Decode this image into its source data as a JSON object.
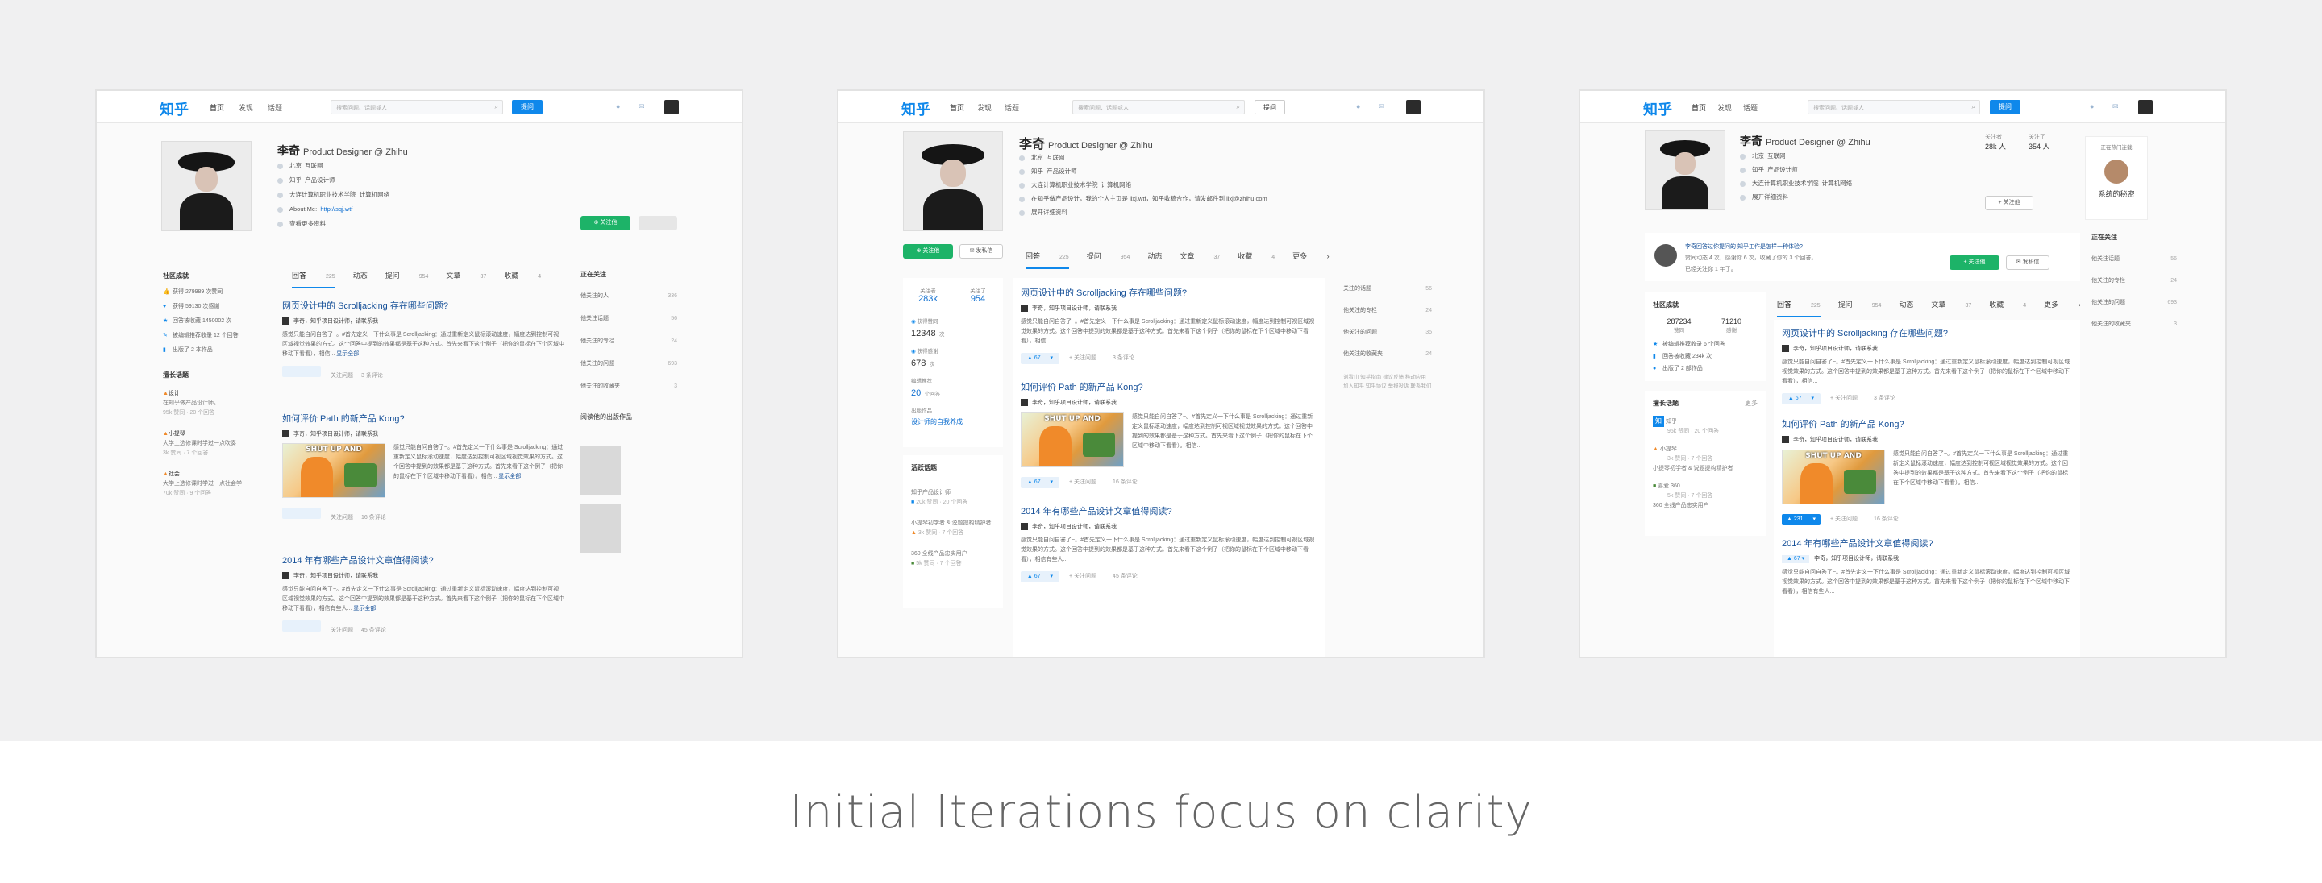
{
  "caption": "Initial Iterations focus on clarity",
  "header": {
    "logo": "知乎",
    "nav": [
      "首页",
      "发现",
      "话题"
    ],
    "search_placeholder": "搜索问题、话题或人",
    "ask_label": "提问"
  },
  "profile": {
    "name": "李奇",
    "headline": "Product Designer @ Zhihu",
    "location": "北京",
    "industry": "互联网",
    "company": "知乎",
    "job": "产品设计师",
    "school": "大连计算机职业技术学院",
    "major": "计算机网络",
    "about_label": "About Me:",
    "about_link": "http://sqj.wtf",
    "bio": "在知乎做产品设计，我的个人主页是 lixj.wtf，知乎收稿合作，请发邮件到 lixj@zhihu.com",
    "show_more": "查看更多资料",
    "expand_more": "展开详细资料",
    "follow_label": "关注他",
    "message_label": "发私信"
  },
  "tabs": [
    {
      "label": "回答",
      "count": "225"
    },
    {
      "label": "动态",
      "count": ""
    },
    {
      "label": "提问",
      "count": "954"
    },
    {
      "label": "文章",
      "count": "37"
    },
    {
      "label": "收藏",
      "count": "4"
    },
    {
      "label": "更多",
      "count": ""
    }
  ],
  "answers": [
    {
      "title": "网页设计中的 Scrolljacking 存在哪些问题?",
      "author": "李奇，知乎项目设计师，请联系我",
      "excerpt": "感觉只能自问自答了~。#首先定义一下什么事是 Scrolljacking：通过重新定义鼠标滚动速度，幅度达到控制可视区域视觉效果的方式。这个回答中提到的效果都是基于这种方式。首先来看下这个例子（把你的鼠标在下个区域中移动下看看），相信...",
      "more": "显示全部",
      "votes": "67",
      "comments": "3 条评论",
      "follow": "关注问题"
    },
    {
      "title": "如何评价 Path 的新产品 Kong?",
      "author": "李奇，知乎项目设计师，请联系我",
      "excerpt": "感觉只能自问自答了~。#首先定义一下什么事是 Scrolljacking：通过重新定义鼠标滚动速度，幅度达到控制可视区域视觉效果的方式。这个回答中提到的效果都是基于这种方式。首先来看下这个例子（把你的鼠标在下个区域中移动下看看）。相信...",
      "more": "显示全部",
      "meme": "SHUT UP AND",
      "votes": "231",
      "comments": "16 条评论",
      "follow": "关注问题"
    },
    {
      "title": "2014 年有哪些产品设计文章值得阅读?",
      "author": "李奇，知乎项目设计师，请联系我",
      "excerpt": "感觉只能自问自答了~。#首先定义一下什么事是 Scrolljacking：通过重新定义鼠标滚动速度，幅度达到控制可视区域视觉效果的方式。这个回答中提到的效果都是基于这种方式。首先来看下这个例子（把你的鼠标在下个区域中移动下看看），相信有些人...",
      "more": "显示全部",
      "votes": "67",
      "comments": "45 条评论",
      "follow": "关注问题"
    }
  ],
  "community": {
    "heading": "社区成就",
    "items": [
      "获得 279989 次赞同",
      "获得 59130 次感谢",
      "回答被收藏 1450002 次",
      "被编辑推荐收录 12 个回答",
      "出版了 2 本作品"
    ]
  },
  "expert": {
    "heading": "擅长话题",
    "topics": [
      {
        "name": "设计",
        "desc": "在知乎做产品设计师。",
        "stats": "95k 赞同 · 20 个回答"
      },
      {
        "name": "小提琴",
        "desc": "大学上选修课时学过一点吹奏",
        "stats": "3k 赞同 · 7 个回答"
      },
      {
        "name": "社会",
        "desc": "大学上选修课时学过一点社会学",
        "stats": "70k 赞同 · 9 个回答"
      }
    ]
  },
  "following": {
    "heading": "正在关注",
    "items": [
      {
        "label": "他关注的人",
        "count": "336"
      },
      {
        "label": "他关注话题",
        "count": "56"
      },
      {
        "label": "他关注的专栏",
        "count": "24"
      },
      {
        "label": "他关注的问题",
        "count": "693"
      },
      {
        "label": "他关注的收藏夹",
        "count": "3"
      }
    ]
  },
  "publications_heading": "阅读他的出版作品",
  "stats": {
    "followers_label": "关注者",
    "followers": "283k",
    "following_label": "关注了",
    "following": "954",
    "views_label": "获得赞同",
    "views": "12348",
    "thanks_label": "获得感谢",
    "thanks": "678",
    "recommend_label": "编辑推荐",
    "recommend": "20",
    "pub_label": "出版作品",
    "pub_value": "设计师的自我养成",
    "count_unit": "次",
    "answer_unit": "个回答",
    "followers3": "28k",
    "following3": "354",
    "community3_a": "287234",
    "community3_a_lbl": "赞同",
    "community3_b": "71210",
    "community3_b_lbl": "感谢"
  },
  "shot2_side": {
    "topic_heading": "活跃话题",
    "topics": [
      {
        "name": "知乎产品设计师",
        "stats": "20k 赞同 · 20 个回答"
      },
      {
        "name": "小提琴初学者 & 说题提构精护者",
        "stats": "3k 赞同 · 7 个回答"
      },
      {
        "name": "360 全线产品忠实用户",
        "stats": "5k 赞同 · 7 个回答"
      }
    ],
    "right_items": [
      {
        "label": "关注的话题",
        "count": "56"
      },
      {
        "label": "他关注的专栏",
        "count": "24"
      },
      {
        "label": "他关注的问题",
        "count": "35"
      },
      {
        "label": "他关注的收藏夹",
        "count": "24"
      }
    ],
    "footer": "刘看山 知乎指南 建议反馈 移动应用 加入知乎 知乎协议 举报投诉 联系我们"
  },
  "shot3": {
    "notice": "李奇回答过你提问的 知乎工作是怎样一种体验?",
    "notice_sub": "赞同动态 4 次，感谢你 6 次，收藏了你的 3 个回答。",
    "notice_sub2": "已经关注你 1 年了。",
    "hot_label": "正在热门连载",
    "book": "系统的秘密",
    "topics": [
      {
        "name": "知乎",
        "stats": "95k 赞同 · 20 个回答"
      },
      {
        "name": "小提琴",
        "stats": "3k 赞同 · 7 个回答"
      },
      {
        "name": "小提琴初学者 & 说题提构精护者",
        "stats": ""
      },
      {
        "name": "喜爱 360",
        "stats": "5k 赞同 · 7 个回答"
      },
      {
        "name": "360 全线产品忠实用户",
        "stats": ""
      }
    ],
    "community_items": [
      "被编辑推荐收录 6 个回答",
      "回答被收藏 234k 次",
      "出版了 2 部作品"
    ],
    "topic_more": "更多"
  },
  "colors": {
    "accent": "#0f88eb",
    "follow": "#1db368",
    "link": "#175199",
    "stage_bg": "#f0f0f1"
  }
}
